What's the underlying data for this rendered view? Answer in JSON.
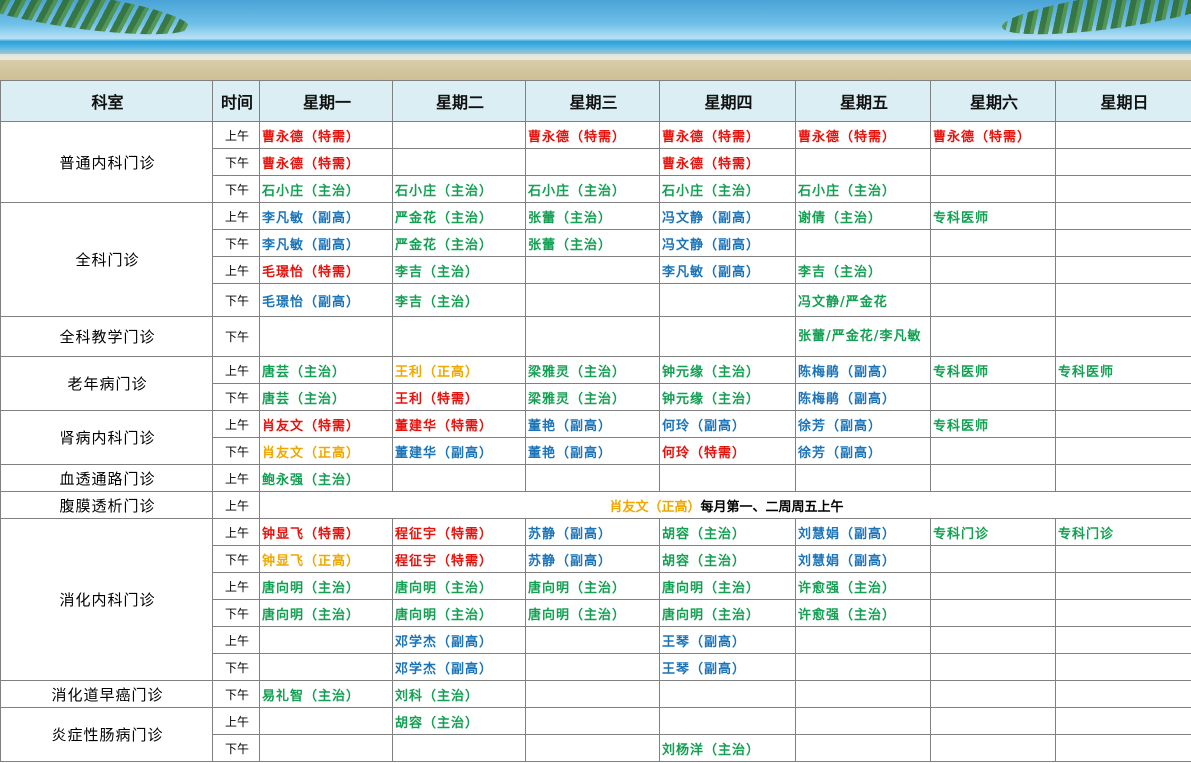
{
  "header": [
    "科室",
    "时间",
    "星期一",
    "星期二",
    "星期三",
    "星期四",
    "星期五",
    "星期六",
    "星期日"
  ],
  "depts": [
    {
      "name": "普通内科门诊",
      "rows": [
        {
          "time": "上午",
          "cells": [
            [
              "曹永德（特需）",
              "red"
            ],
            [
              "",
              ""
            ],
            [
              "曹永德（特需）",
              "red"
            ],
            [
              "曹永德（特需）",
              "red"
            ],
            [
              "曹永德（特需）",
              "red"
            ],
            [
              "曹永德（特需）",
              "red"
            ],
            [
              "",
              ""
            ]
          ]
        },
        {
          "time": "下午",
          "cells": [
            [
              "曹永德（特需）",
              "red"
            ],
            [
              "",
              ""
            ],
            [
              "",
              ""
            ],
            [
              "曹永德（特需）",
              "red"
            ],
            [
              "",
              ""
            ],
            [
              "",
              ""
            ],
            [
              "",
              ""
            ]
          ]
        },
        {
          "time": "下午",
          "cells": [
            [
              "石小庄（主治）",
              "green"
            ],
            [
              "石小庄（主治）",
              "green"
            ],
            [
              "石小庄（主治）",
              "green"
            ],
            [
              "石小庄（主治）",
              "green"
            ],
            [
              "石小庄（主治）",
              "green"
            ],
            [
              "",
              ""
            ],
            [
              "",
              ""
            ]
          ]
        }
      ]
    },
    {
      "name": "全科门诊",
      "rows": [
        {
          "time": "上午",
          "cells": [
            [
              "李凡敏（副高）",
              "blue"
            ],
            [
              "严金花（主治）",
              "green"
            ],
            [
              "张蕾（主治）",
              "green"
            ],
            [
              "冯文静（副高）",
              "blue"
            ],
            [
              "谢倩（主治）",
              "green"
            ],
            [
              "专科医师",
              "green"
            ],
            [
              "",
              ""
            ]
          ]
        },
        {
          "time": "下午",
          "cells": [
            [
              "李凡敏（副高）",
              "blue"
            ],
            [
              "严金花（主治）",
              "green"
            ],
            [
              "张蕾（主治）",
              "green"
            ],
            [
              "冯文静（副高）",
              "blue"
            ],
            [
              "",
              ""
            ],
            [
              "",
              ""
            ],
            [
              "",
              ""
            ]
          ]
        },
        {
          "time": "上午",
          "cells": [
            [
              "毛璟怡（特需）",
              "red"
            ],
            [
              "李吉（主治）",
              "green"
            ],
            [
              "",
              ""
            ],
            [
              "李凡敏（副高）",
              "blue"
            ],
            [
              "李吉（主治）",
              "green"
            ],
            [
              "",
              ""
            ],
            [
              "",
              ""
            ]
          ]
        },
        {
          "time": "下午",
          "tall": true,
          "cells": [
            [
              "毛璟怡（副高）",
              "blue"
            ],
            [
              "李吉（主治）",
              "green"
            ],
            [
              "",
              ""
            ],
            [
              "",
              ""
            ],
            [
              "冯文静/严金花",
              "green"
            ],
            [
              "",
              ""
            ],
            [
              "",
              ""
            ]
          ]
        }
      ]
    },
    {
      "name": "全科教学门诊",
      "rows": [
        {
          "time": "下午",
          "tall": true,
          "cells": [
            [
              "",
              ""
            ],
            [
              "",
              ""
            ],
            [
              "",
              ""
            ],
            [
              "",
              ""
            ],
            [
              "张蕾/严金花/李凡敏",
              "green"
            ],
            [
              "",
              ""
            ],
            [
              "",
              ""
            ]
          ]
        }
      ]
    },
    {
      "name": "老年病门诊",
      "rows": [
        {
          "time": "上午",
          "cells": [
            [
              "唐芸（主治）",
              "green"
            ],
            [
              "王利（正高）",
              "gold"
            ],
            [
              "梁雅灵（主治）",
              "green"
            ],
            [
              "钟元缘（主治）",
              "green"
            ],
            [
              "陈梅鹃（副高）",
              "blue"
            ],
            [
              "专科医师",
              "green"
            ],
            [
              "专科医师",
              "green"
            ]
          ]
        },
        {
          "time": "下午",
          "cells": [
            [
              "唐芸（主治）",
              "green"
            ],
            [
              "王利（特需）",
              "red"
            ],
            [
              "梁雅灵（主治）",
              "green"
            ],
            [
              "钟元缘（主治）",
              "green"
            ],
            [
              "陈梅鹃（副高）",
              "blue"
            ],
            [
              "",
              ""
            ],
            [
              "",
              ""
            ]
          ]
        }
      ]
    },
    {
      "name": "肾病内科门诊",
      "rows": [
        {
          "time": "上午",
          "cells": [
            [
              "肖友文（特需）",
              "red"
            ],
            [
              "董建华（特需）",
              "red"
            ],
            [
              "董艳（副高）",
              "blue"
            ],
            [
              "何玲（副高）",
              "blue"
            ],
            [
              "徐芳（副高）",
              "blue"
            ],
            [
              "专科医师",
              "green"
            ],
            [
              "",
              ""
            ]
          ]
        },
        {
          "time": "下午",
          "cells": [
            [
              "肖友文（正高）",
              "gold"
            ],
            [
              "董建华（副高）",
              "blue"
            ],
            [
              "董艳（副高）",
              "blue"
            ],
            [
              "何玲（特需）",
              "red"
            ],
            [
              "徐芳（副高）",
              "blue"
            ],
            [
              "",
              ""
            ],
            [
              "",
              ""
            ]
          ]
        }
      ]
    },
    {
      "name": "血透通路门诊",
      "rows": [
        {
          "time": "上午",
          "cells": [
            [
              "鲍永强（主治）",
              "green"
            ],
            [
              "",
              ""
            ],
            [
              "",
              ""
            ],
            [
              "",
              ""
            ],
            [
              "",
              ""
            ],
            [
              "",
              ""
            ],
            [
              "",
              ""
            ]
          ]
        }
      ]
    },
    {
      "name": "腹膜透析门诊",
      "rows": [
        {
          "time": "上午",
          "merged": true,
          "note_a": "肖友文（正高）",
          "note_b": "每月第一、二周周五上午"
        }
      ]
    },
    {
      "name": "消化内科门诊",
      "rows": [
        {
          "time": "上午",
          "cells": [
            [
              "钟显飞（特需）",
              "red"
            ],
            [
              "程征宇（特需）",
              "red"
            ],
            [
              "苏静（副高）",
              "blue"
            ],
            [
              "胡容（主治）",
              "green"
            ],
            [
              "刘慧娟（副高）",
              "blue"
            ],
            [
              "专科门诊",
              "green"
            ],
            [
              "专科门诊",
              "green"
            ]
          ]
        },
        {
          "time": "下午",
          "cells": [
            [
              "钟显飞（正高）",
              "gold"
            ],
            [
              "程征宇（特需）",
              "red"
            ],
            [
              "苏静（副高）",
              "blue"
            ],
            [
              "胡容（主治）",
              "green"
            ],
            [
              "刘慧娟（副高）",
              "blue"
            ],
            [
              "",
              ""
            ],
            [
              "",
              ""
            ]
          ]
        },
        {
          "time": "上午",
          "cells": [
            [
              "唐向明（主治）",
              "green"
            ],
            [
              "唐向明（主治）",
              "green"
            ],
            [
              "唐向明（主治）",
              "green"
            ],
            [
              "唐向明（主治）",
              "green"
            ],
            [
              "许愈强（主治）",
              "green"
            ],
            [
              "",
              ""
            ],
            [
              "",
              ""
            ]
          ]
        },
        {
          "time": "下午",
          "cells": [
            [
              "唐向明（主治）",
              "green"
            ],
            [
              "唐向明（主治）",
              "green"
            ],
            [
              "唐向明（主治）",
              "green"
            ],
            [
              "唐向明（主治）",
              "green"
            ],
            [
              "许愈强（主治）",
              "green"
            ],
            [
              "",
              ""
            ],
            [
              "",
              ""
            ]
          ]
        },
        {
          "time": "上午",
          "cells": [
            [
              "",
              ""
            ],
            [
              "邓学杰（副高）",
              "blue"
            ],
            [
              "",
              ""
            ],
            [
              "王琴（副高）",
              "blue"
            ],
            [
              "",
              ""
            ],
            [
              "",
              ""
            ],
            [
              "",
              ""
            ]
          ]
        },
        {
          "time": "下午",
          "cells": [
            [
              "",
              ""
            ],
            [
              "邓学杰（副高）",
              "blue"
            ],
            [
              "",
              ""
            ],
            [
              "王琴（副高）",
              "blue"
            ],
            [
              "",
              ""
            ],
            [
              "",
              ""
            ],
            [
              "",
              ""
            ]
          ]
        }
      ]
    },
    {
      "name": "消化道早癌门诊",
      "rows": [
        {
          "time": "下午",
          "cells": [
            [
              "易礼智（主治）",
              "green"
            ],
            [
              "刘科（主治）",
              "green"
            ],
            [
              "",
              ""
            ],
            [
              "",
              ""
            ],
            [
              "",
              ""
            ],
            [
              "",
              ""
            ],
            [
              "",
              ""
            ]
          ]
        }
      ]
    },
    {
      "name": "炎症性肠病门诊",
      "rows": [
        {
          "time": "上午",
          "cells": [
            [
              "",
              ""
            ],
            [
              "胡容（主治）",
              "green"
            ],
            [
              "",
              ""
            ],
            [
              "",
              ""
            ],
            [
              "",
              ""
            ],
            [
              "",
              ""
            ],
            [
              "",
              ""
            ]
          ]
        },
        {
          "time": "下午",
          "cells": [
            [
              "",
              ""
            ],
            [
              "",
              ""
            ],
            [
              "",
              ""
            ],
            [
              "刘杨洋（主治）",
              "green"
            ],
            [
              "",
              ""
            ],
            [
              "",
              ""
            ],
            [
              "",
              ""
            ]
          ]
        }
      ]
    }
  ],
  "colors": {
    "red": "#e8120c",
    "green": "#13a052",
    "blue": "#1b74b8",
    "gold": "#f0a800",
    "header_bg": "#daeef3"
  }
}
